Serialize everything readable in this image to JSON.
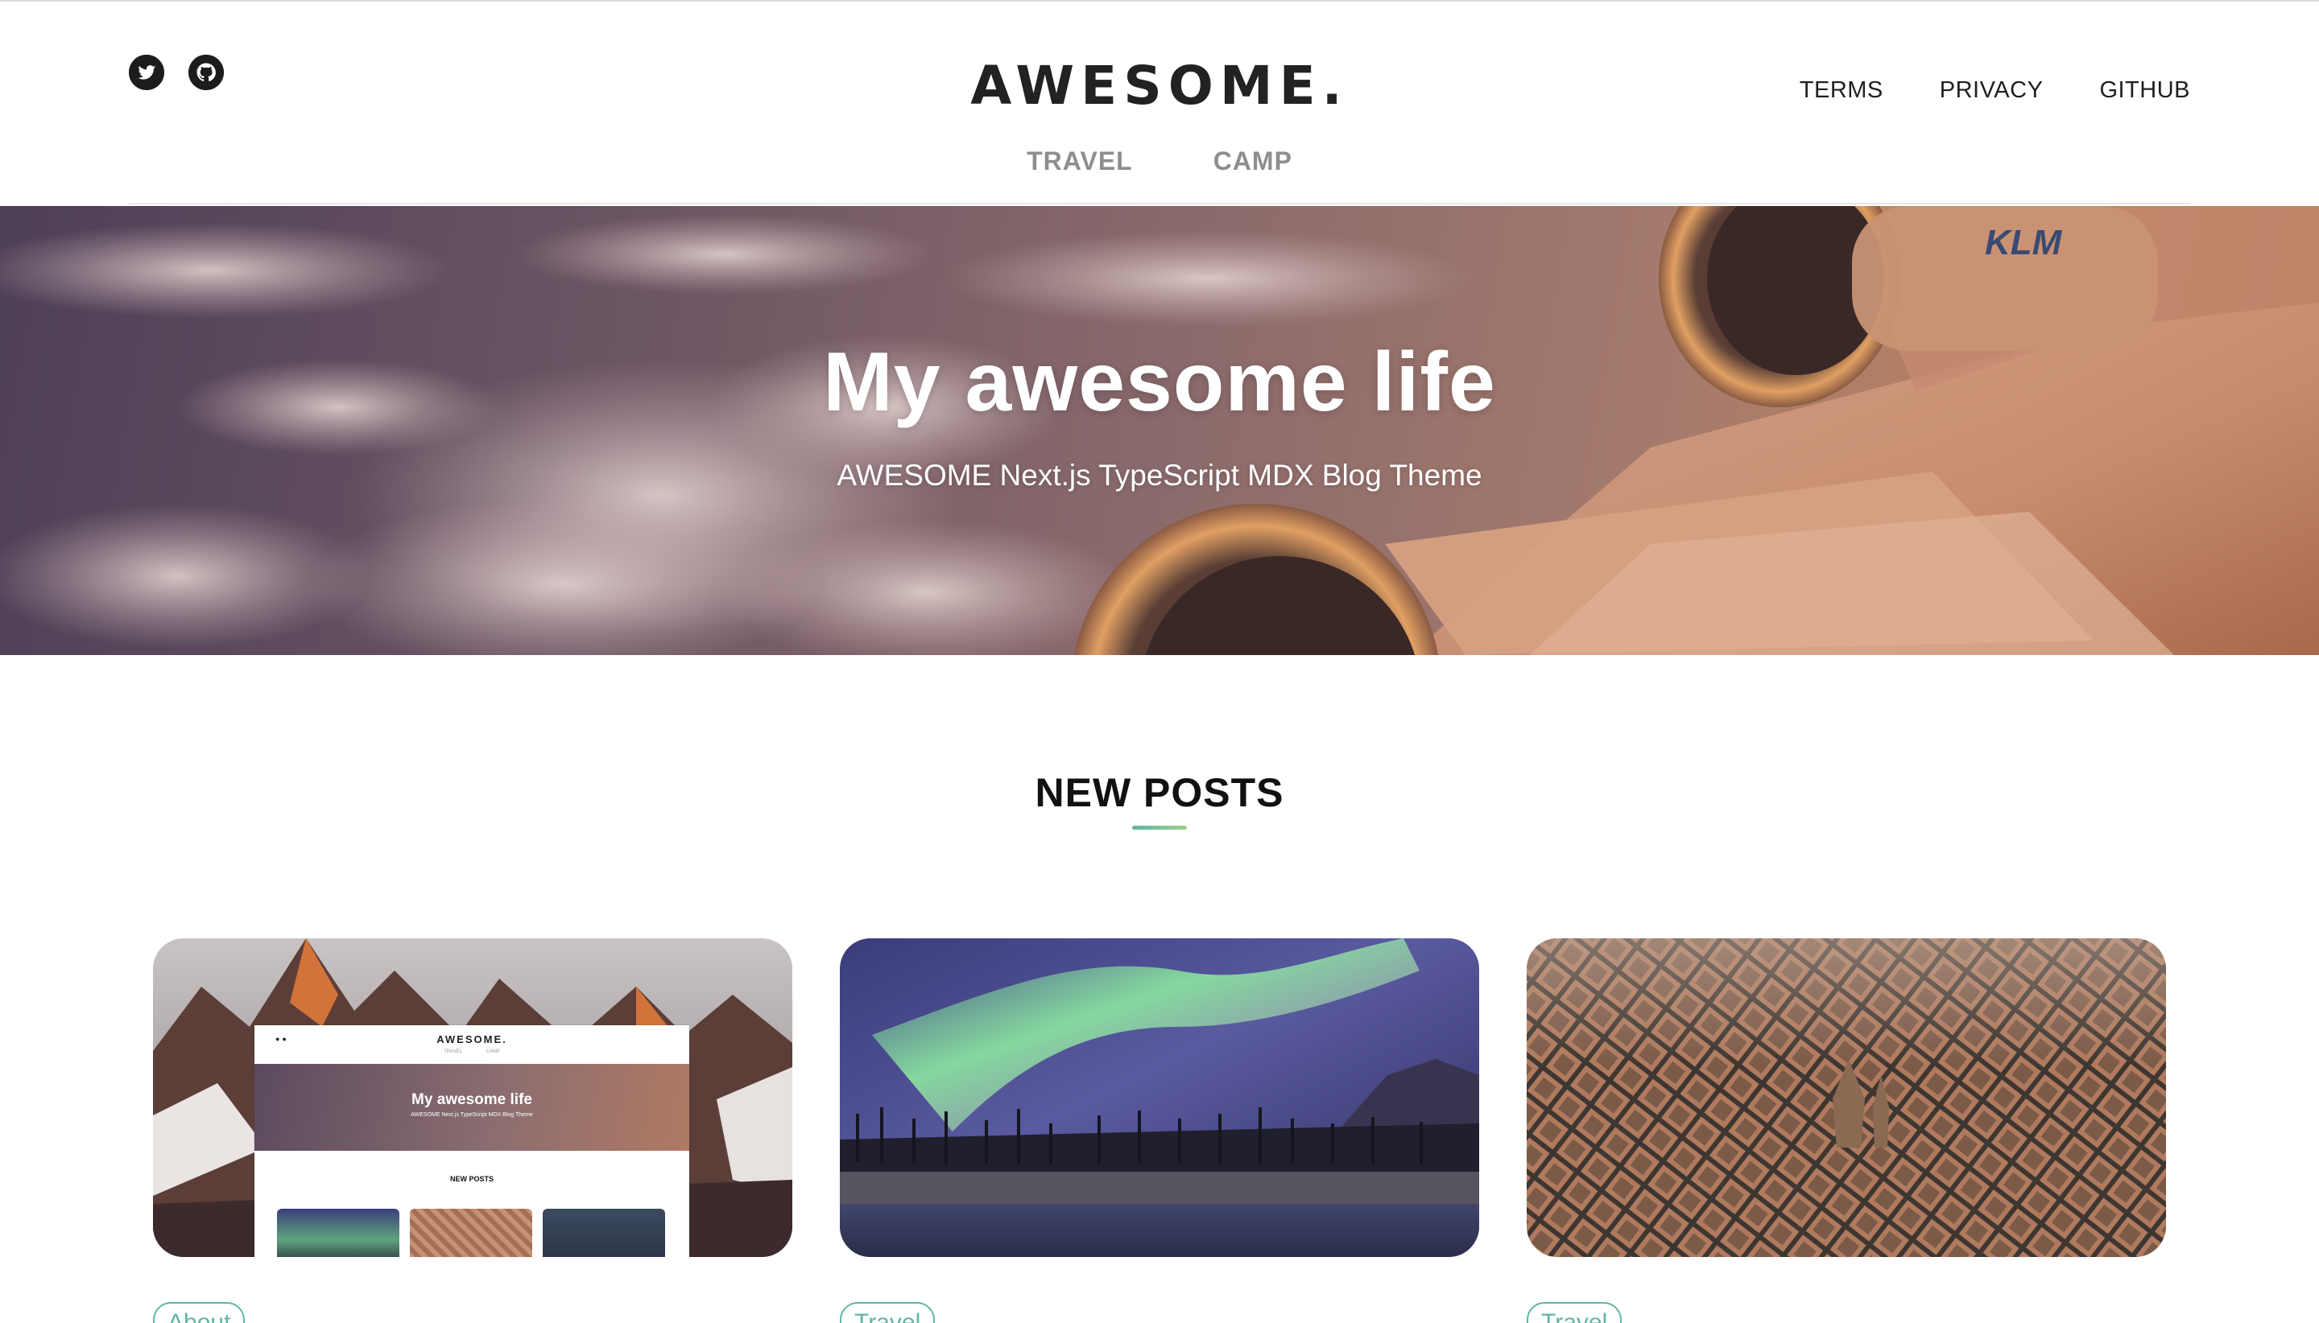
{
  "header": {
    "brand": "AWESOME.",
    "social_icons": [
      "twitter-icon",
      "github-icon"
    ],
    "categories": [
      {
        "label": "TRAVEL"
      },
      {
        "label": "CAMP"
      }
    ],
    "page_links": [
      {
        "label": "TERMS"
      },
      {
        "label": "PRIVACY"
      },
      {
        "label": "GITHUB"
      }
    ]
  },
  "hero": {
    "title": "My awesome life",
    "subtitle": "AWESOME Next.js TypeScript MDX Blog Theme",
    "image_text": "KLM"
  },
  "new_posts": {
    "heading": "NEW POSTS",
    "posts": [
      {
        "tag": "About",
        "thumbnail": "blog-theme-screenshot",
        "mini": {
          "brand": "AWESOME.",
          "nav": "TRAVEL CAMP",
          "title": "My awesome life",
          "subtitle": "AWESOME Next.js TypeScript MDX Blog Theme",
          "section": "NEW POSTS"
        }
      },
      {
        "tag": "Travel",
        "thumbnail": "aurora-over-lake"
      },
      {
        "tag": "Travel",
        "thumbnail": "aerial-city-view"
      }
    ]
  },
  "colors": {
    "accent": "#5fb6a4",
    "accent_light": "#9fcf8a",
    "nav_muted": "#8e8e8e",
    "text_dark": "#1f1f1f"
  }
}
